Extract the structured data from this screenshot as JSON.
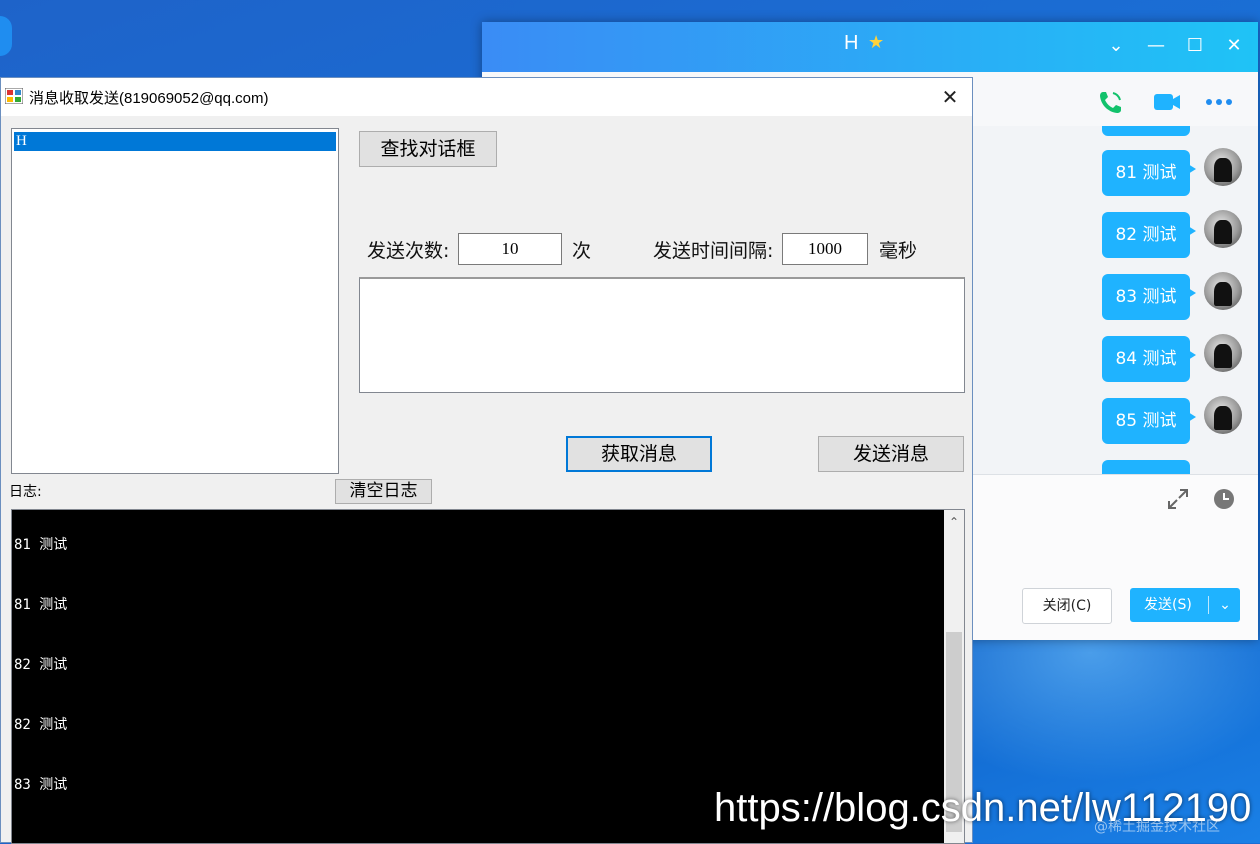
{
  "qq_window": {
    "title": "H",
    "star_icon": "★",
    "controls": {
      "dropdown": "⌄",
      "minimize": "—",
      "maximize": "☐",
      "close": "✕"
    },
    "messages": [
      {
        "text": "81 测试"
      },
      {
        "text": "82 测试"
      },
      {
        "text": "83 测试"
      },
      {
        "text": "84 测试"
      },
      {
        "text": "85 测试"
      }
    ],
    "close_button": "关闭(C)",
    "send_button": "发送(S)",
    "send_dropdown": "⌄"
  },
  "tool_window": {
    "title": "消息收取发送(819069052@qq.com)",
    "close_glyph": "✕",
    "window_list": [
      "H"
    ],
    "find_button": "查找对话框",
    "send_count_label": "发送次数:",
    "send_count_value": "10",
    "send_count_unit": "次",
    "interval_label": "发送时间间隔:",
    "interval_value": "1000",
    "interval_unit": "毫秒",
    "message_text": "",
    "get_button": "获取消息",
    "send_button": "发送消息",
    "log_label": "日志:",
    "clear_log_button": "清空日志",
    "log_lines": [
      "81 测试",
      "81 测试",
      "82 测试",
      "82 测试",
      "83 测试"
    ],
    "scroll_up": "⌃"
  },
  "watermark": {
    "url": "https://blog.csdn.net/lw112190",
    "community": "@稀土掘金技术社区"
  },
  "colors": {
    "qq_title_start": "#3a8cf5",
    "qq_title_end": "#1fc3f6",
    "bubble": "#1fb3ff",
    "selection": "#0078d7",
    "log_bg": "#000000"
  }
}
